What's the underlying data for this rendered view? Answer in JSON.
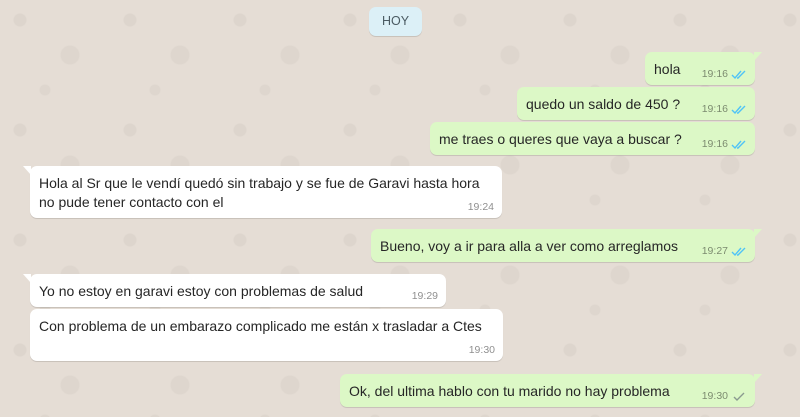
{
  "day_label": "HOY",
  "colors": {
    "outgoing_bubble": "#dcf8c6",
    "incoming_bubble": "#ffffff",
    "read_tick": "#4fc3f7",
    "sent_tick": "#8a9a8f",
    "background": "#e5ddd5"
  },
  "messages": [
    {
      "direction": "outgoing",
      "text": "hola",
      "time": "19:16",
      "status": "read"
    },
    {
      "direction": "outgoing",
      "text": "quedo un saldo de 450 ?",
      "time": "19:16",
      "status": "read"
    },
    {
      "direction": "outgoing",
      "text": "me traes o queres que vaya a buscar ?",
      "time": "19:16",
      "status": "read"
    },
    {
      "direction": "incoming",
      "text": "Hola al Sr que le vendí quedó sin trabajo y se fue de Garavi hasta hora\nno pude tener contacto con el",
      "time": "19:24"
    },
    {
      "direction": "outgoing",
      "text": "Bueno, voy a ir para alla a ver como arreglamos",
      "time": "19:27",
      "status": "read"
    },
    {
      "direction": "incoming",
      "text": "Yo no estoy en garavi estoy con problemas de salud",
      "time": "19:29"
    },
    {
      "direction": "incoming",
      "text": "Con problema de un embarazo complicado me están x trasladar a Ctes",
      "time": "19:30"
    },
    {
      "direction": "outgoing",
      "text": "Ok, del ultima hablo con tu marido no hay problema",
      "time": "19:30",
      "status": "sent"
    }
  ]
}
